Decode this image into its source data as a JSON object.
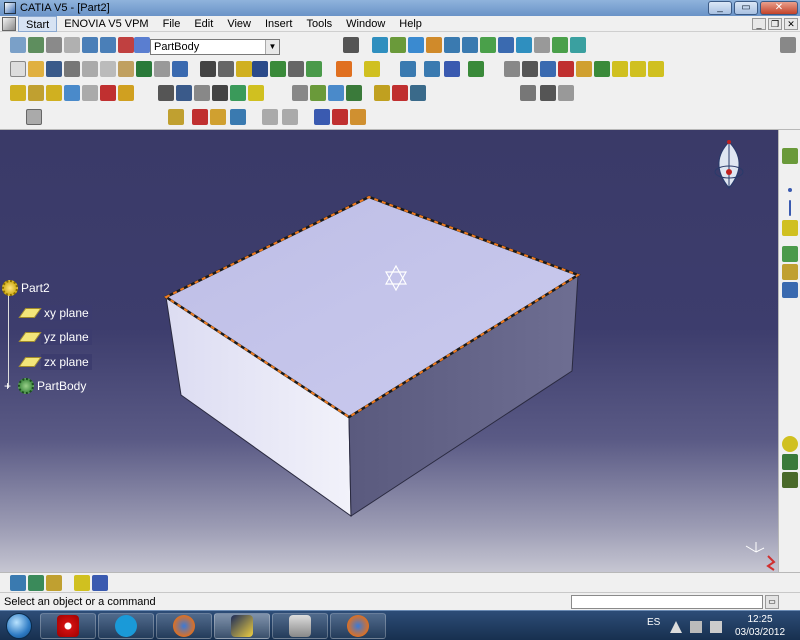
{
  "window": {
    "title": "CATIA V5 - [Part2]",
    "controls": {
      "minimize": "_",
      "maximize": "▭",
      "close": "✕"
    }
  },
  "menubar": {
    "items": [
      "Start",
      "ENOVIA V5 VPM",
      "File",
      "Edit",
      "View",
      "Insert",
      "Tools",
      "Window",
      "Help"
    ]
  },
  "toolbar": {
    "current_body_combo": "PartBody",
    "combo_arrow": "▼"
  },
  "spec_tree": {
    "root": "Part2",
    "children": [
      "xy plane",
      "yz plane",
      "zx plane",
      "PartBody"
    ]
  },
  "statusbar": {
    "message": "Select an object or a command",
    "command_input": ""
  },
  "taskbar": {
    "language": "ES",
    "time": "12:25",
    "date": "03/03/2012"
  },
  "colors": {
    "viewport_top": "#3a3a68",
    "viewport_bottom": "#c6c6d2",
    "box_top": "#c4c4e8",
    "box_front": "#e0e0f4",
    "box_right": "#5c5c80",
    "edge_highlight": "#f07c20"
  }
}
